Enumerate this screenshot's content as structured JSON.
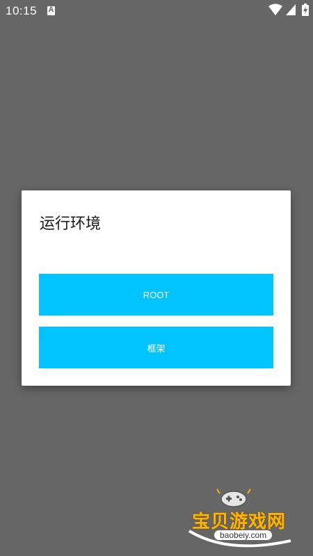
{
  "status_bar": {
    "time": "10:15",
    "notification_icon": "a-icon",
    "icons": [
      "wifi-icon",
      "signal-icon",
      "battery-charging-icon"
    ]
  },
  "dialog": {
    "title": "运行环境",
    "buttons": [
      {
        "label": "ROOT"
      },
      {
        "label": "框架"
      }
    ],
    "button_color": "#00c3ff"
  },
  "watermark": {
    "text": "宝贝游戏网",
    "url": "baobeiy.com"
  },
  "colors": {
    "scrim": "#666666",
    "dialog_bg": "#ffffff",
    "accent": "#00c3ff"
  }
}
